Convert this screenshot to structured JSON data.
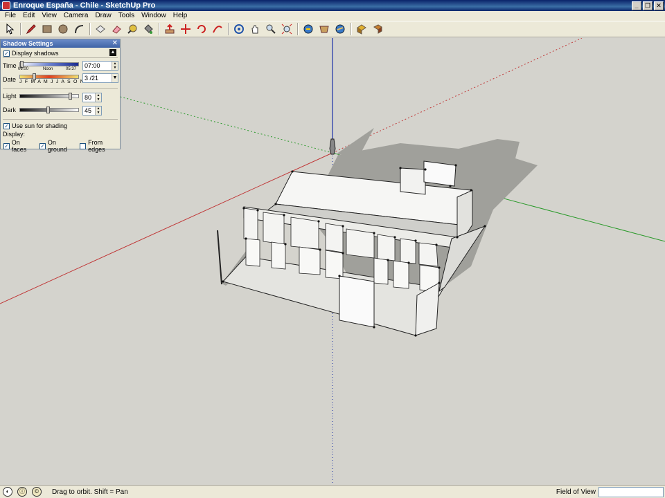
{
  "window": {
    "title": "Enroque España - Chile - SketchUp Pro"
  },
  "menu": [
    "File",
    "Edit",
    "View",
    "Camera",
    "Draw",
    "Tools",
    "Window",
    "Help"
  ],
  "toolbar": {
    "tools": [
      "select-tool",
      "pencil-tool",
      "rectangle-tool",
      "circle-tool",
      "arc-tool",
      "make-component-tool",
      "eraser-tool",
      "tape-measure-tool",
      "paint-bucket-tool",
      "push-pull-tool",
      "move-tool",
      "rotate-tool",
      "follow-me-tool",
      "orbit-tool",
      "pan-tool",
      "zoom-tool",
      "zoom-extents-tool",
      "previous-view-tool",
      "next-view-tool",
      "get-models-tool",
      "share-model-tool",
      "components-tool"
    ]
  },
  "shadow_panel": {
    "title": "Shadow Settings",
    "display_shadows": "Display shadows",
    "time_label": "Time",
    "time_start": "06:00",
    "time_noon": "Noon",
    "time_end": "05:37",
    "time_value": "07:00",
    "date_label": "Date",
    "months": "J F M A M J J A S O N D",
    "date_value": "3 /21",
    "light_label": "Light",
    "light_value": "80",
    "dark_label": "Dark",
    "dark_value": "45",
    "use_sun": "Use sun for shading",
    "display_label": "Display:",
    "on_faces": "On faces",
    "on_ground": "On ground",
    "from_edges": "From edges",
    "time_slider_pos": 0.05,
    "light_slider_pos": 0.85,
    "dark_slider_pos": 0.5
  },
  "status": {
    "hint": "Drag to orbit.  Shift = Pan",
    "vcb_label": "Field of View",
    "vcb_value": ""
  }
}
